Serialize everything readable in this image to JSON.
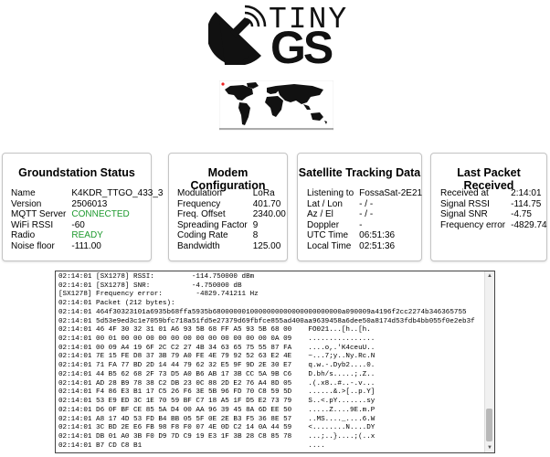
{
  "logo": {
    "word1": "TINY",
    "word2": "GS"
  },
  "cards": {
    "groundstation": {
      "title": "Groundstation Status",
      "rows": [
        {
          "k": "Name",
          "v": "K4KDR_TTGO_433_3"
        },
        {
          "k": "Version",
          "v": "2506013"
        },
        {
          "k": "MQTT Server",
          "v": "CONNECTED"
        },
        {
          "k": "WiFi RSSI",
          "v": "-60"
        },
        {
          "k": "Radio",
          "v": "READY"
        },
        {
          "k": "Noise floor",
          "v": "-111.00"
        }
      ]
    },
    "modem": {
      "title": "Modem Configuration",
      "rows": [
        {
          "k": "Modulation",
          "v": "LoRa"
        },
        {
          "k": "Frequency",
          "v": "401.70"
        },
        {
          "k": "Freq. Offset",
          "v": "2340.00"
        },
        {
          "k": "Spreading Factor",
          "v": "9"
        },
        {
          "k": "Coding Rate",
          "v": "8"
        },
        {
          "k": "Bandwidth",
          "v": "125.00"
        }
      ]
    },
    "satellite": {
      "title": "Satellite Tracking Data",
      "rows": [
        {
          "k": "Listening to",
          "v": "FossaSat-2E21"
        },
        {
          "k": "Lat / Lon",
          "v": "- / -"
        },
        {
          "k": "Az / El",
          "v": "- / -"
        },
        {
          "k": "Doppler",
          "v": "-"
        },
        {
          "k": "UTC Time",
          "v": "06:51:36"
        },
        {
          "k": "Local Time",
          "v": "02:51:36"
        }
      ]
    },
    "packet": {
      "title": "Last Packet Received",
      "rows": [
        {
          "k": "Received at",
          "v": "2:14:01"
        },
        {
          "k": "Signal RSSI",
          "v": "-114.75"
        },
        {
          "k": "Signal SNR",
          "v": "-4.75"
        },
        {
          "k": "Frequency error",
          "v": "-4829.74"
        }
      ]
    }
  },
  "colors": {
    "ok": "#1f9a2f"
  },
  "console_log": "02:14:01 [SX1278] RSSI:         -114.750000 dBm\n02:14:01 [SX1278] SNR:          -4.750000 dB\n[SX1278] Frequency error:        -4829.741211 Hz\n02:14:01 Packet (212 bytes):\n02:14:01 464f30323101a6935b68ffa5935b6800000010000000000000000000000a090009a4196f2cc2274b346365755\n02:14:01 5d53e9ed3c1e7059bfc718a51fd5e27379d69fbfce855ad400aa9639458a6dee50a8174d53fdb4bb055f0e2eb3f\n02:14:01 46 4F 30 32 31 01 A6 93 5B 68 FF A5 93 5B 68 00    FO021...[h..[h.\n02:14:01 00 01 00 00 00 00 00 00 00 00 00 00 00 00 0A 09    ................\n02:14:01 00 09 A4 19 6F 2C C2 27 4B 34 63 65 75 55 87 FA    ....o,.'K4ceuU..\n02:14:01 7E 15 FE D8 37 3B 79 A0 FE 4E 79 92 52 63 E2 4E    ~...7;y..Ny.Rc.N\n02:14:01 71 FA 77 BD 2D 14 44 79 62 32 E5 9F 9D 2E 30 E7    q.w.-.Dyb2....0.\n02:14:01 44 B5 62 68 2F 73 D5 A0 B6 AB 17 3B CC 5A 9B C6    D.bh/s.....;.Z..\n02:14:01 AD 28 B9 78 38 C2 DB 23 0C 88 2D E2 76 A4 8D 05    .(.x8..#..-.v...\n02:14:01 F4 86 E3 B1 17 C5 26 F6 3E 5B 96 FD 70 C8 59 5D    ......&.>[..p.Y]\n02:14:01 53 E9 ED 3C 1E 70 59 BF C7 18 A5 1F D5 E2 73 79    S..<.pY.......sy\n02:14:01 D6 0F BF CE 85 5A D4 00 AA 96 39 45 8A 6D EE 50    .....Z....9E.m.P\n02:14:01 A8 17 4D 53 FD B4 BB 05 5F 0E 2E B3 F5 36 8E 57    ..MS...._....6.W\n02:14:01 3C BD 2E E6 FB 98 F8 F0 07 4E 0D C2 14 0A 44 59    <........N....DY\n02:14:01 DB 01 A0 3B F0 D9 7D C9 19 E3 1F 3B 28 C8 85 78    ...;..}....;(..x\n02:14:01 B7 CD C8 B1                                        ...."
}
